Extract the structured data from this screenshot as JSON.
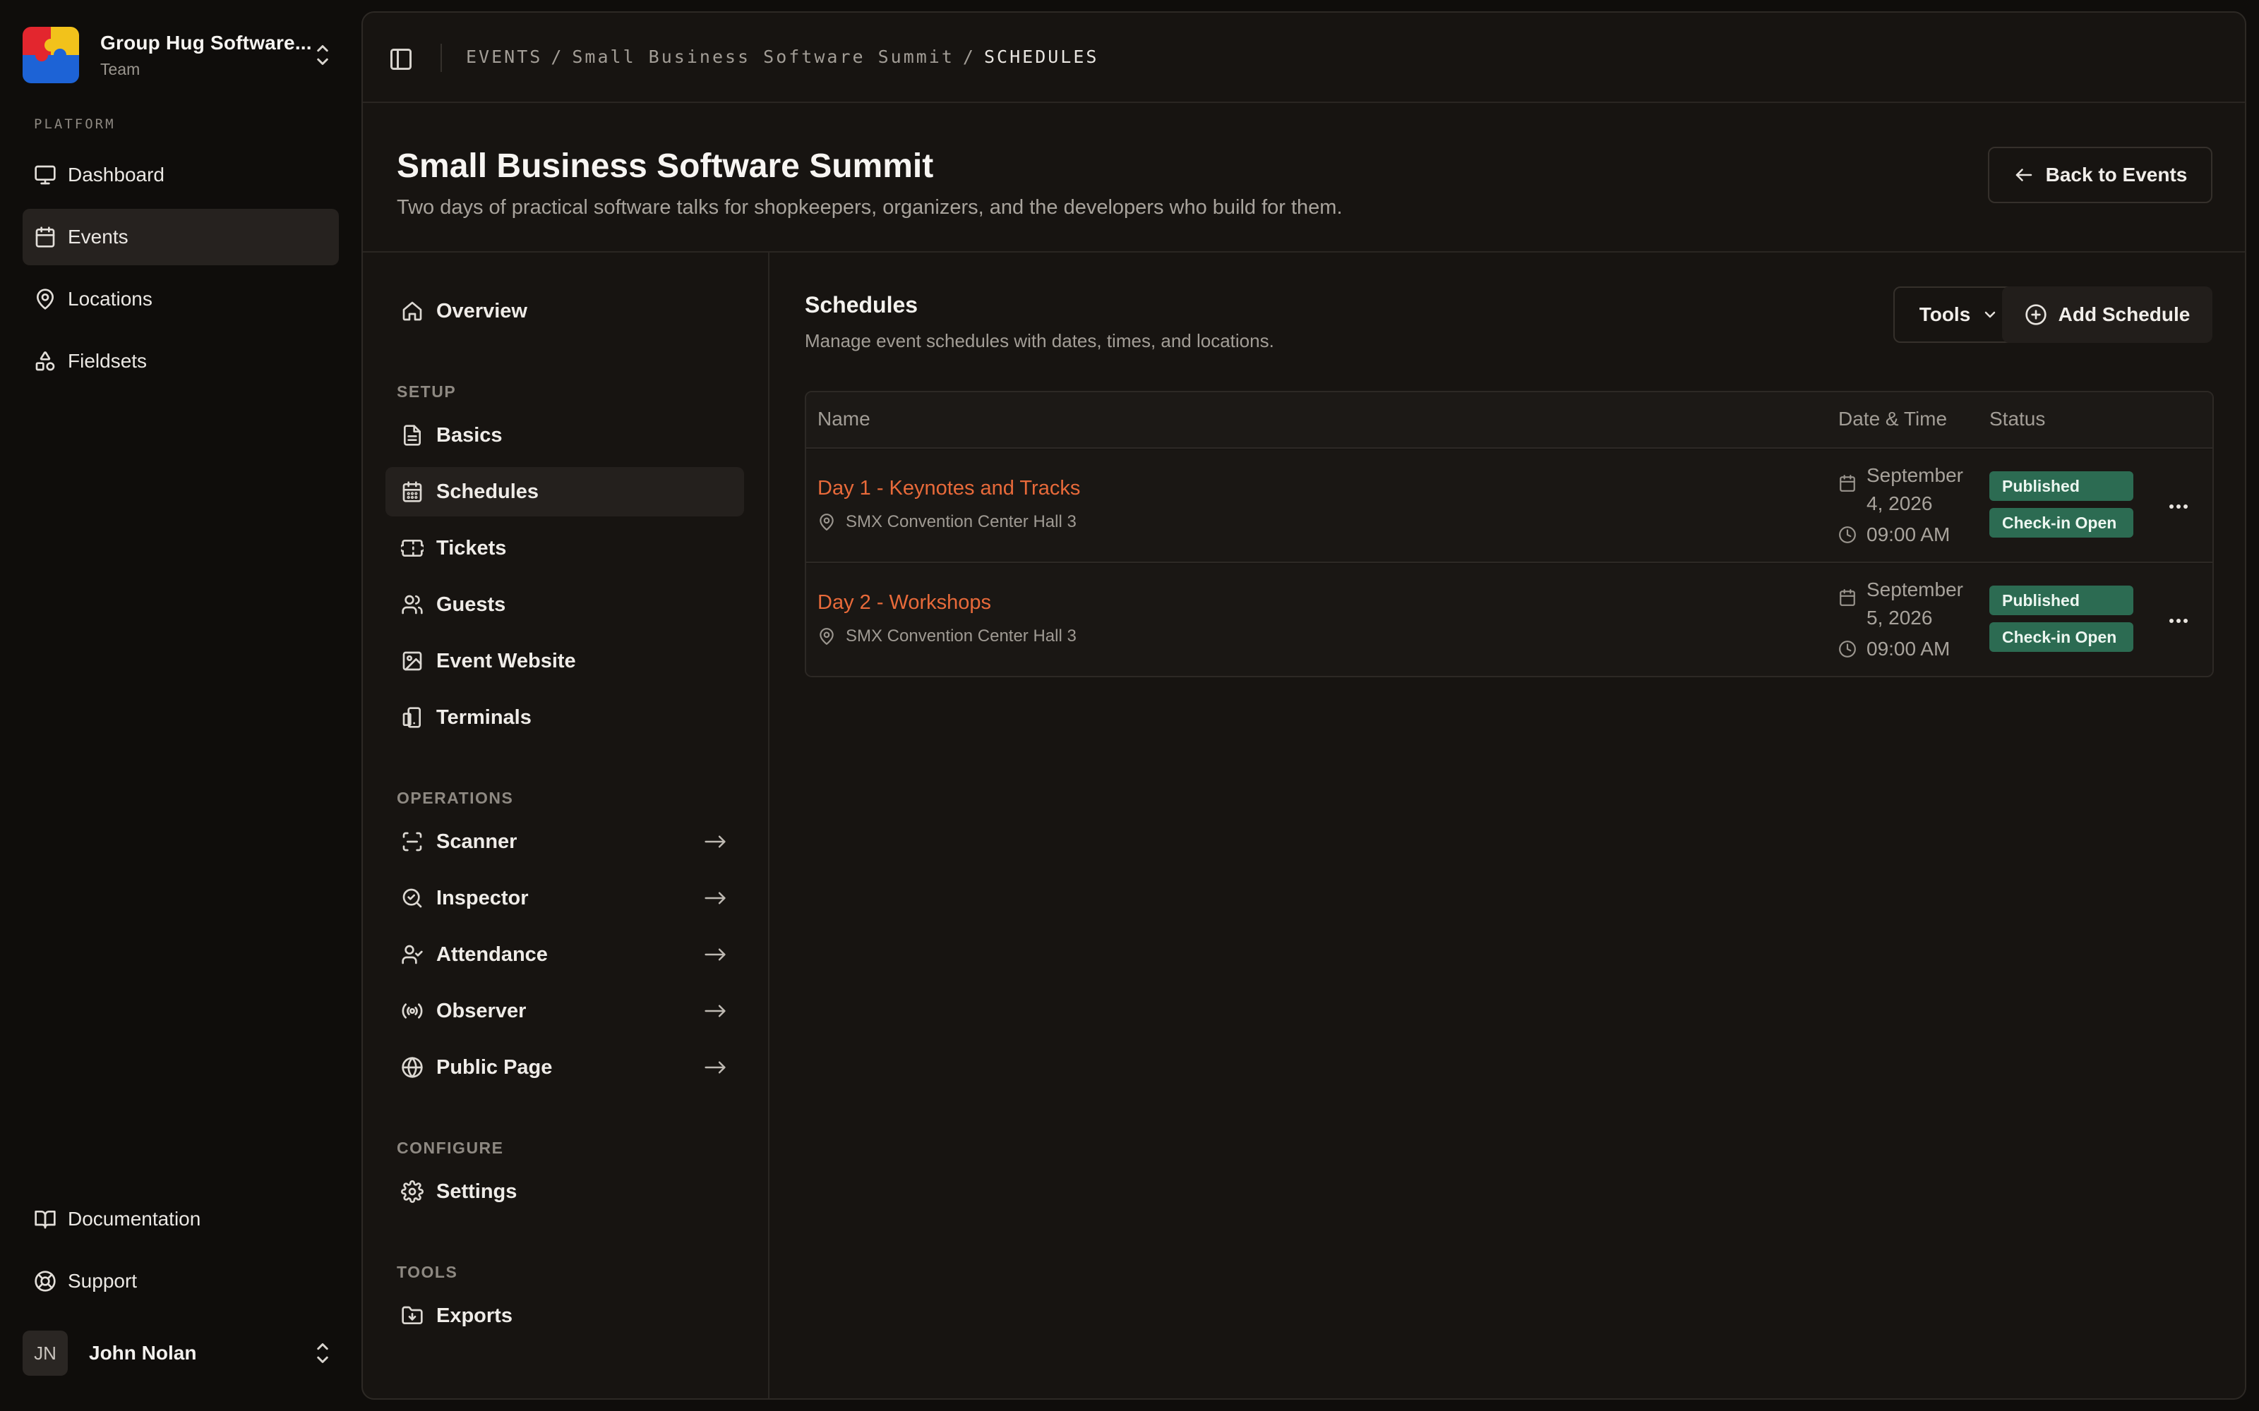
{
  "team": {
    "name": "Group Hug Software...",
    "role": "Team"
  },
  "platform": {
    "label": "PLATFORM",
    "items": [
      {
        "label": "Dashboard",
        "icon": "monitor-icon"
      },
      {
        "label": "Events",
        "icon": "calendar-icon",
        "active": true
      },
      {
        "label": "Locations",
        "icon": "map-pin-icon"
      },
      {
        "label": "Fieldsets",
        "icon": "shapes-icon"
      }
    ]
  },
  "footer_nav": [
    {
      "label": "Documentation",
      "icon": "book-icon"
    },
    {
      "label": "Support",
      "icon": "life-buoy-icon"
    }
  ],
  "user": {
    "initials": "JN",
    "name": "John Nolan"
  },
  "breadcrumb": {
    "root": "EVENTS",
    "event": "Small Business Software Summit",
    "current": "SCHEDULES",
    "sep": "/"
  },
  "event": {
    "title": "Small Business Software Summit",
    "description": "Two days of practical software talks for shopkeepers, organizers, and the developers who build for them.",
    "back_label": "Back to Events"
  },
  "subnav": {
    "overview": "Overview",
    "setup_heading": "SETUP",
    "setup": [
      "Basics",
      "Schedules",
      "Tickets",
      "Guests",
      "Event Website",
      "Terminals"
    ],
    "operations_heading": "OPERATIONS",
    "operations": [
      "Scanner",
      "Inspector",
      "Attendance",
      "Observer",
      "Public Page"
    ],
    "configure_heading": "CONFIGURE",
    "configure": [
      "Settings"
    ],
    "tools_heading": "TOOLS",
    "tools": [
      "Exports"
    ]
  },
  "schedules": {
    "title": "Schedules",
    "description": "Manage event schedules with dates, times, and locations.",
    "tools_label": "Tools",
    "add_label": "Add Schedule",
    "columns": {
      "name": "Name",
      "datetime": "Date & Time",
      "status": "Status"
    },
    "rows": [
      {
        "name": "Day 1 - Keynotes and Tracks",
        "location": "SMX Convention Center Hall 3",
        "date": "September 4, 2026",
        "time": "09:00 AM",
        "status": [
          "Published",
          "Check-in Open"
        ]
      },
      {
        "name": "Day 2 - Workshops",
        "location": "SMX Convention Center Hall 3",
        "date": "September 5, 2026",
        "time": "09:00 AM",
        "status": [
          "Published",
          "Check-in Open"
        ]
      }
    ]
  },
  "colors": {
    "accent_link": "#e86a3a",
    "badge_green": "#2c6b52",
    "background": "#0f0d0b",
    "panel": "#171411"
  }
}
